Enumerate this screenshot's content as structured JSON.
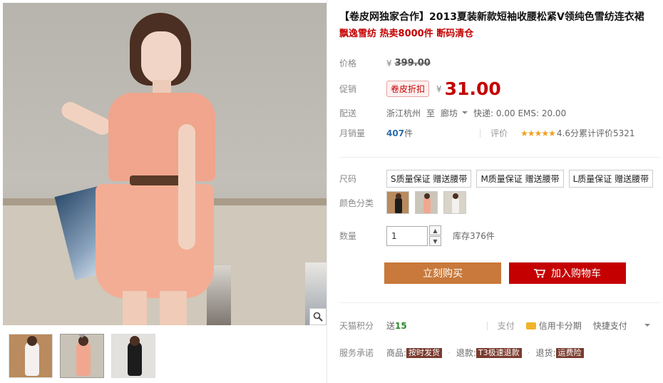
{
  "gallery": {
    "thumbnails": [
      {
        "name": "thumb-1",
        "bg": "#b98b5e",
        "dress": "#f4f0ee"
      },
      {
        "name": "thumb-2",
        "bg": "#c9c2b6",
        "dress": "#f1a78f"
      },
      {
        "name": "thumb-3",
        "bg": "#e3e1de",
        "dress": "#1c1c1c"
      }
    ],
    "active_index": 1
  },
  "product": {
    "title": "【卷皮网独家合作】2013夏装新款短袖收腰松紧V领纯色雪纺连衣裙",
    "subtitle": "飘逸雪纺 热卖8000件 断码清仓"
  },
  "price": {
    "label": "价格",
    "currency": "¥",
    "original": "399.00"
  },
  "promo": {
    "label": "促销",
    "tag": "卷皮折扣",
    "currency": "¥",
    "price": "31.00"
  },
  "shipping": {
    "label": "配送",
    "from": "浙江杭州",
    "to_word": "至",
    "to": "廊坊",
    "fees": "快递: 0.00 EMS: 20.00"
  },
  "sales": {
    "label": "月销量",
    "count": "407",
    "unit": "件",
    "review_label": "评价",
    "stars": "★★★★★",
    "score": "4.6分",
    "review_text": "累计评价5321"
  },
  "sizes": {
    "label": "尺码",
    "options": [
      "S质量保证 赠送腰带",
      "M质量保证 赠送腰带",
      "L质量保证 赠送腰带"
    ]
  },
  "colors": {
    "label": "颜色分类",
    "swatches": [
      {
        "bg": "#b98b5e",
        "dress": "#1c1c1c"
      },
      {
        "bg": "#cbc5ba",
        "dress": "#f1a78f"
      },
      {
        "bg": "#d9d3c9",
        "dress": "#f4f0ee"
      }
    ]
  },
  "quantity": {
    "label": "数量",
    "value": "1",
    "up": "▲",
    "down": "▼",
    "stock": "库存376件"
  },
  "buttons": {
    "buy_now": "立刻购买",
    "add_cart": "加入购物车"
  },
  "points": {
    "label": "天猫积分",
    "send": "送",
    "amount": "15",
    "pay_label": "支付",
    "credit": "信用卡分期",
    "quick": "快捷支付"
  },
  "service": {
    "label": "服务承诺",
    "goods_label": "商品:",
    "goods_tag": "按时发货",
    "return_label": "退款:",
    "return_tag": "T3极速退款",
    "ret_label": "退货:",
    "ret_tag": "运费险"
  },
  "colors_ui": {
    "accent_red": "#c40000",
    "buy_orange": "#c8793b"
  }
}
